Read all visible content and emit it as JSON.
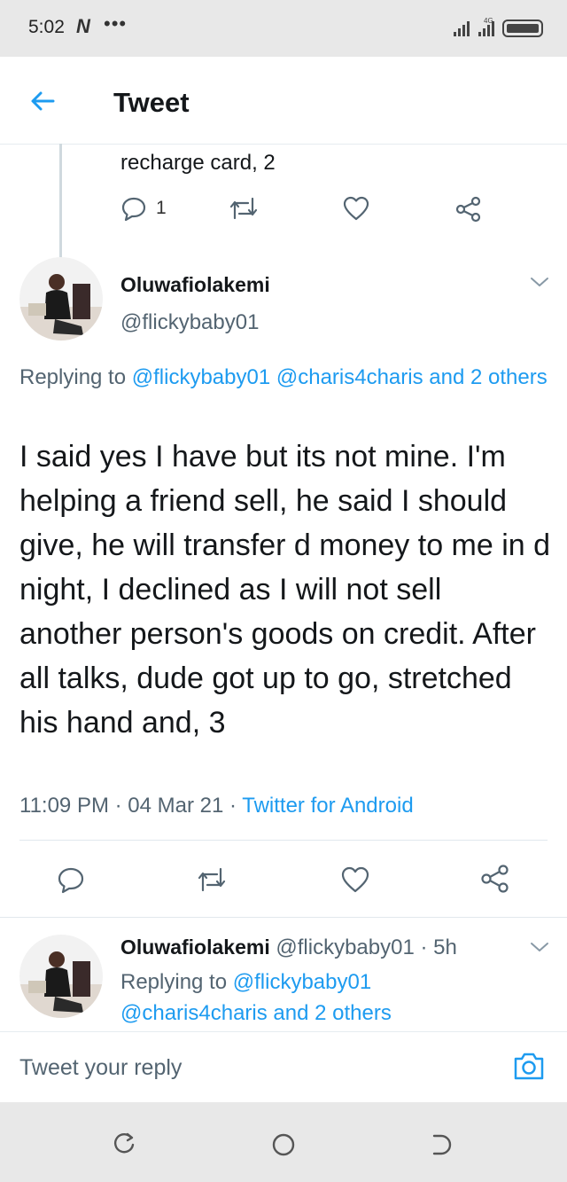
{
  "status_bar": {
    "time": "5:02",
    "carrier_logo": "N",
    "dots": "•••",
    "network": "4G"
  },
  "header": {
    "title": "Tweet"
  },
  "previous_tweet": {
    "text": "recharge card, 2",
    "reply_count": "1"
  },
  "main_tweet": {
    "name": "Oluwafiolakemi",
    "handle": "@flickybaby01",
    "replying_prefix": "Replying to ",
    "replying_mentions": "@flickybaby01 @charis4charis and 2 others",
    "body": "I said yes I have but its not mine. I'm helping a friend sell, he said I should give, he will transfer d money to me in d night, I declined as I will not sell another person's goods on credit. After all talks, dude got up to go, stretched his hand and, 3",
    "time": "11:09 PM",
    "sep": " · ",
    "date": "04 Mar 21",
    "source": "Twitter for Android"
  },
  "next_tweet": {
    "name": "Oluwafiolakemi",
    "handle": "@flickybaby01",
    "age": "· 5h",
    "replying_prefix": "Replying to ",
    "mention1": "@flickybaby01",
    "mention2": "@charis4charis and 2 others"
  },
  "composer": {
    "placeholder": "Tweet your reply"
  },
  "colors": {
    "accent": "#1d9bf0",
    "text": "#14171a",
    "secondary": "#536471"
  },
  "icons": [
    "back-arrow-icon",
    "reply-icon",
    "retweet-icon",
    "like-icon",
    "share-icon",
    "chevron-down-icon",
    "camera-icon",
    "recent-apps-icon",
    "home-icon",
    "back-nav-icon"
  ]
}
